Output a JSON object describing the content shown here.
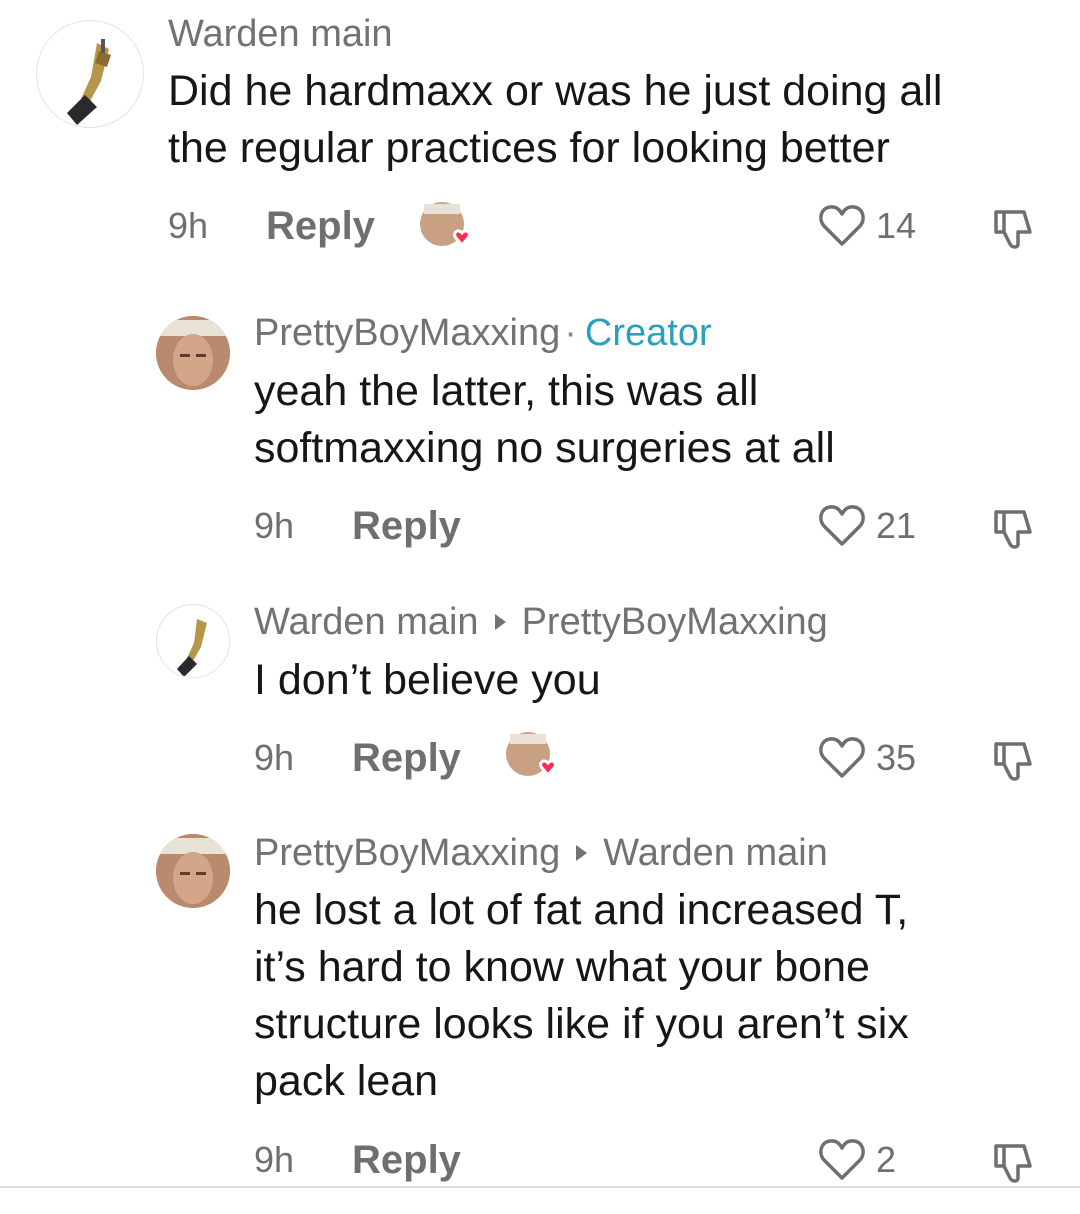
{
  "comments": [
    {
      "author": "Warden main",
      "text_lines": [
        "Did he hardmaxx or was he just doing all",
        "the regular practices for looking better"
      ],
      "time": "9h",
      "reply_label": "Reply",
      "likes": "14",
      "creator_liked": true
    },
    {
      "author": "PrettyBoyMaxxing",
      "dot": "·",
      "badge": "Creator",
      "text_lines": [
        "yeah the latter, this was all",
        "softmaxxing no surgeries at all"
      ],
      "time": "9h",
      "reply_label": "Reply",
      "likes": "21",
      "creator_liked": false
    },
    {
      "author": "Warden main",
      "reply_to": "PrettyBoyMaxxing",
      "text_lines": [
        "I don’t believe you"
      ],
      "time": "9h",
      "reply_label": "Reply",
      "likes": "35",
      "creator_liked": true
    },
    {
      "author": "PrettyBoyMaxxing",
      "reply_to": "Warden main",
      "text_lines": [
        "he lost a lot of fat and increased T,",
        "it’s hard to know what your bone",
        "structure looks like if you aren’t six",
        "pack lean"
      ],
      "time": "9h",
      "reply_label": "Reply",
      "likes": "2",
      "creator_liked": false
    }
  ],
  "colors": {
    "creator_badge": "#2aa0bd",
    "liked_heart": "#fe2c55",
    "muted": "#6f6f6f"
  },
  "icons": {
    "like": "heart-outline-icon",
    "dislike": "thumbs-down-icon",
    "creator_like": "creator-liked-badge"
  }
}
